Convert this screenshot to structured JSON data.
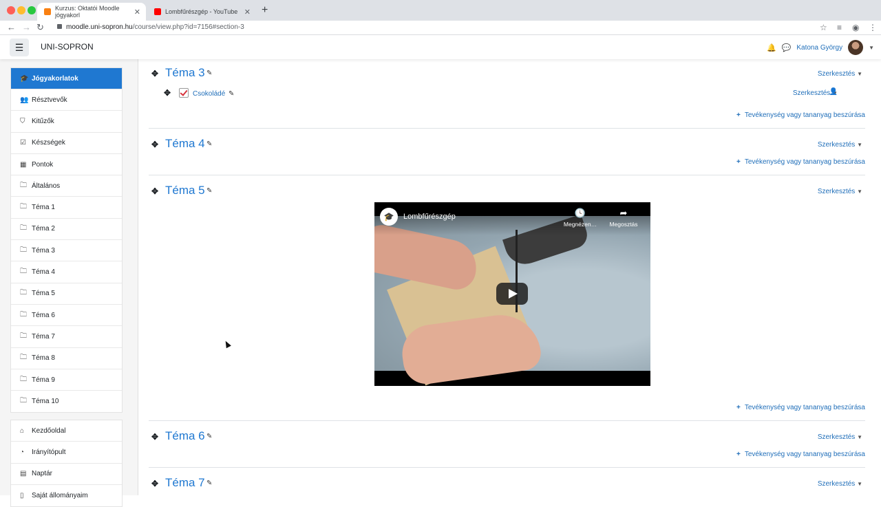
{
  "browser": {
    "tabs": [
      {
        "title": "Kurzus: Oktatói Moodle jógyakorl",
        "active": true
      },
      {
        "title": "Lombfűrészgép - YouTube",
        "active": false
      }
    ],
    "url_host": "moodle.uni-sopron.hu",
    "url_path": "/course/view.php?id=7156#section-3"
  },
  "navbar": {
    "brand": "UNI-SOPRON",
    "user_name": "Katona György"
  },
  "drawer": {
    "course_items": [
      {
        "label": "Jógyakorlatok",
        "icon": "graduation-cap-icon",
        "glyph": "🎓",
        "active": true
      },
      {
        "label": "Résztvevők",
        "icon": "users-icon",
        "glyph": "👥"
      },
      {
        "label": "Kitűzők",
        "icon": "shield-icon",
        "glyph": "⛉"
      },
      {
        "label": "Készségek",
        "icon": "checkbox-icon",
        "glyph": "☑"
      },
      {
        "label": "Pontok",
        "icon": "table-icon",
        "glyph": "▦"
      },
      {
        "label": "Általános",
        "icon": "folder-icon",
        "glyph": "🗀"
      },
      {
        "label": "Téma 1",
        "icon": "folder-icon",
        "glyph": "🗀"
      },
      {
        "label": "Téma 2",
        "icon": "folder-icon",
        "glyph": "🗀"
      },
      {
        "label": "Téma 3",
        "icon": "folder-icon",
        "glyph": "🗀"
      },
      {
        "label": "Téma 4",
        "icon": "folder-icon",
        "glyph": "🗀"
      },
      {
        "label": "Téma 5",
        "icon": "folder-icon",
        "glyph": "🗀"
      },
      {
        "label": "Téma 6",
        "icon": "folder-icon",
        "glyph": "🗀"
      },
      {
        "label": "Téma 7",
        "icon": "folder-icon",
        "glyph": "🗀"
      },
      {
        "label": "Téma 8",
        "icon": "folder-icon",
        "glyph": "🗀"
      },
      {
        "label": "Téma 9",
        "icon": "folder-icon",
        "glyph": "🗀"
      },
      {
        "label": "Téma 10",
        "icon": "folder-icon",
        "glyph": "🗀"
      }
    ],
    "site_items": [
      {
        "label": "Kezdőoldal",
        "icon": "home-icon",
        "glyph": "⌂"
      },
      {
        "label": "Irányítópult",
        "icon": "dashboard-icon",
        "glyph": "◔"
      },
      {
        "label": "Naptár",
        "icon": "calendar-icon",
        "glyph": "▤"
      },
      {
        "label": "Saját állományaim",
        "icon": "file-icon",
        "glyph": "▯"
      }
    ]
  },
  "main": {
    "edit_label": "Szerkesztés",
    "add_activity_label": "Tevékenység vagy tananyag beszúrása",
    "sections": [
      {
        "title": "Téma 3"
      },
      {
        "title": "Téma 4"
      },
      {
        "title": "Téma 5"
      },
      {
        "title": "Téma 6"
      },
      {
        "title": "Téma 7"
      }
    ],
    "activity": {
      "name": "Csokoládé"
    },
    "video": {
      "title": "Lombfűrészgép",
      "watch_later": "Megnézen…",
      "share": "Megosztás"
    }
  },
  "colors": {
    "accent": "#1f78d1",
    "link": "#1f6eb9"
  }
}
